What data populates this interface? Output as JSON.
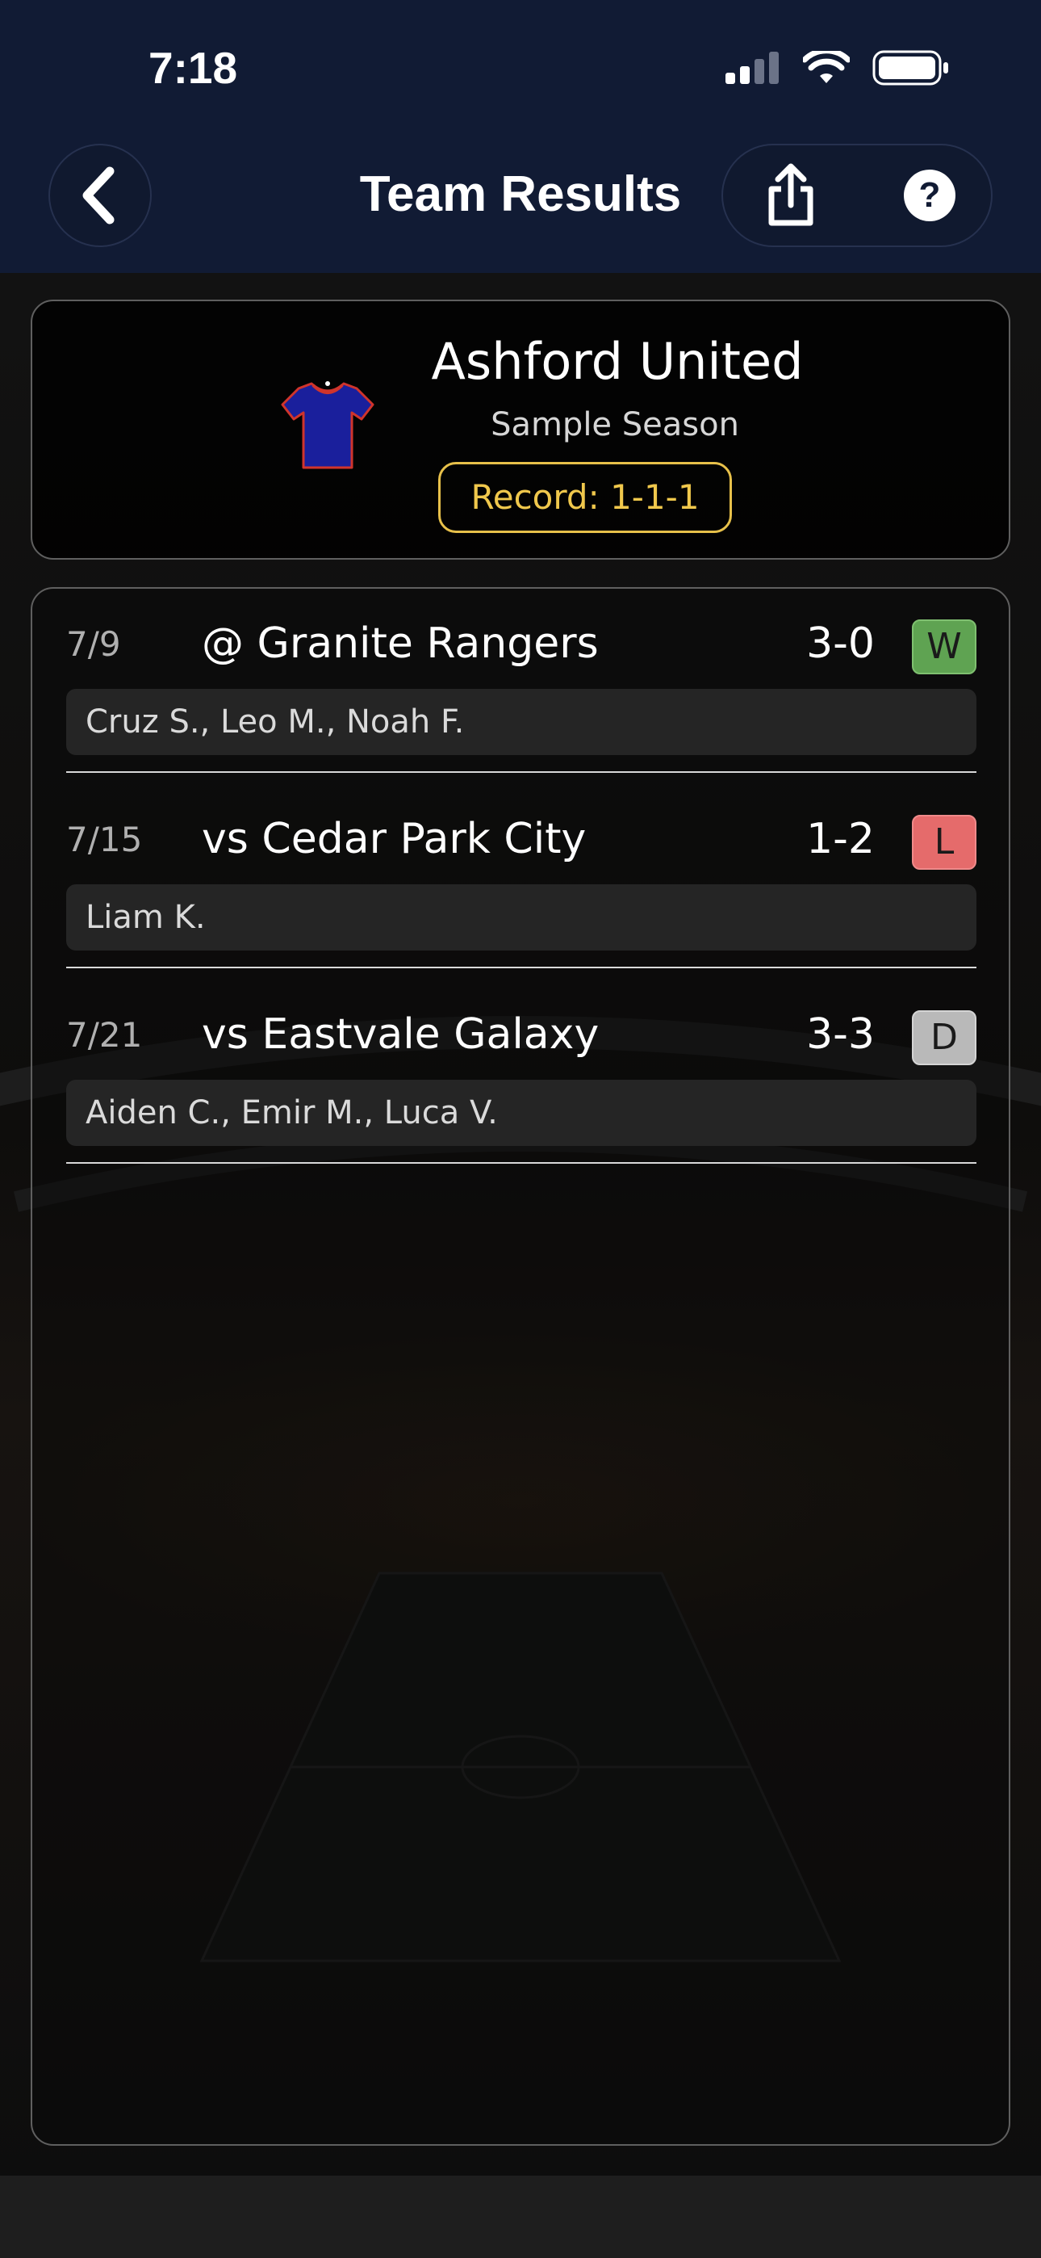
{
  "status_bar": {
    "time": "7:18",
    "icons": [
      "cellular-signal-icon",
      "wifi-icon",
      "battery-icon"
    ]
  },
  "header": {
    "title": "Team Results",
    "back_icon": "chevron-left-icon",
    "share_icon": "share-icon",
    "help_icon": "question-icon",
    "help_glyph": "?"
  },
  "team": {
    "name": "Ashford United",
    "season": "Sample Season",
    "record": "Record: 1-1-1",
    "jersey_icon": "jersey-icon",
    "jersey_color": "#1a1f9c",
    "jersey_trim_color": "#d0342c"
  },
  "matches": [
    {
      "date": "7/9",
      "opponent": "@ Granite Rangers",
      "score": "3-0",
      "result": "W",
      "scorers": "Cruz S., Leo M., Noah F."
    },
    {
      "date": "7/15",
      "opponent": "vs Cedar Park City",
      "score": "1-2",
      "result": "L",
      "scorers": "Liam K."
    },
    {
      "date": "7/21",
      "opponent": "vs Eastvale Galaxy",
      "score": "3-3",
      "result": "D",
      "scorers": "Aiden C., Emir M., Luca V."
    }
  ],
  "colors": {
    "header_bg": "#111b34",
    "win": "#5fa352",
    "loss": "#e56b6b",
    "draw": "#b9b9b9",
    "record_accent": "#f0c84c"
  }
}
